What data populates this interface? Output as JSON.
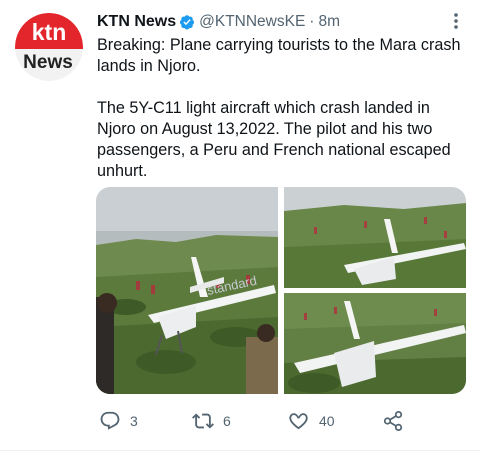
{
  "account": {
    "display_name": "KTN News",
    "handle": "@KTNNewsKE",
    "separator": "·",
    "timestamp": "8m",
    "logo_text_top": "ktn",
    "logo_text_bottom": "News",
    "verified": true
  },
  "tweet": {
    "paragraph_1": "Breaking: Plane carrying tourists to the Mara crash lands in Njoro.",
    "paragraph_2": "The 5Y-C11 light aircraft which crash landed in Njoro on August 13,2022. The pilot and his two passengers, a Peru and French national escaped unhurt."
  },
  "media": {
    "photo_count": 3,
    "photo_1_watermark": "standard"
  },
  "actions": {
    "reply_count": "3",
    "retweet_count": "6",
    "like_count": "40"
  },
  "colors": {
    "text": "#0f1419",
    "secondary": "#536471",
    "verified": "#1d9bf0",
    "ktn_red": "#e3262b"
  },
  "icons": [
    "verified-badge-icon",
    "more-icon",
    "reply-icon",
    "retweet-icon",
    "like-icon",
    "share-icon"
  ]
}
